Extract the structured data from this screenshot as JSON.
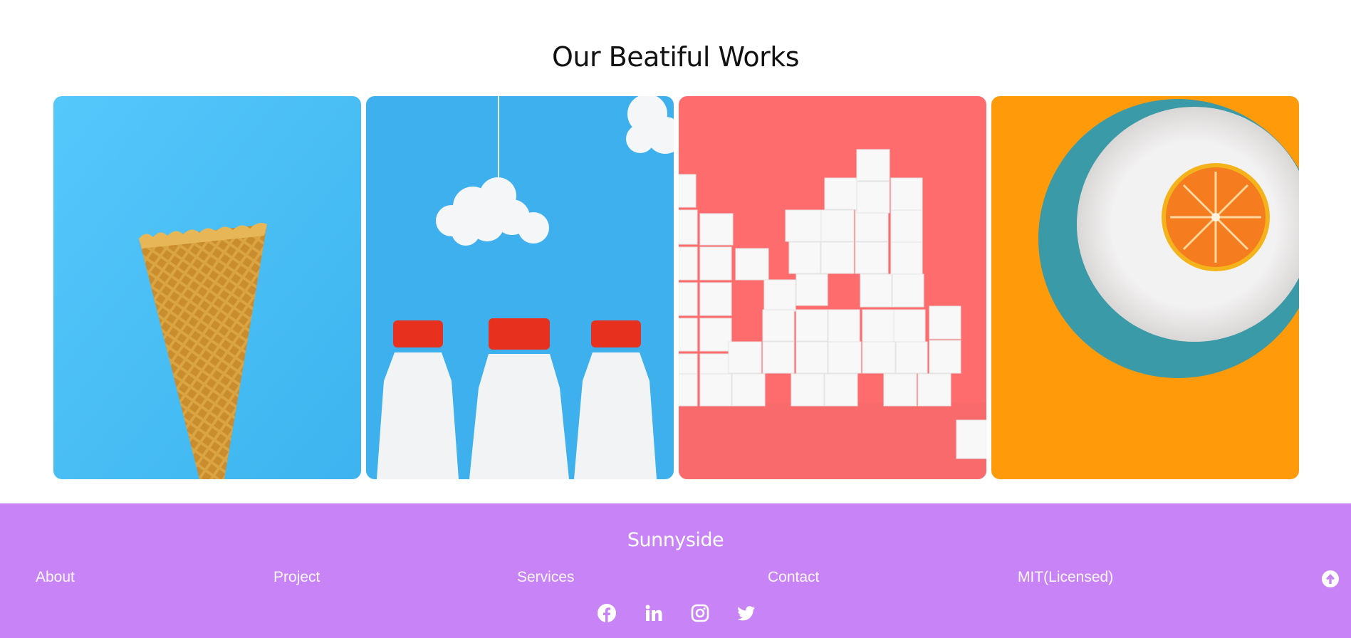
{
  "works": {
    "title": "Our Beatiful Works",
    "tiles": [
      {
        "subject": "ice-cream-cone",
        "bg": "#4fc3f7"
      },
      {
        "subject": "milk-bottles",
        "bg": "#3eaeec"
      },
      {
        "subject": "sugar-cubes",
        "bg": "#ff6b6b"
      },
      {
        "subject": "orange-on-plate",
        "bg": "#ff9c0a"
      }
    ]
  },
  "footer": {
    "bg": "#c883f7",
    "brand": "Sunnyside",
    "links": [
      "About",
      "Project",
      "Services",
      "Contact",
      "MIT(Licensed)"
    ],
    "scroll_top_icon": "arrow-up-circle-icon",
    "social": [
      "facebook-icon",
      "linkedin-icon",
      "instagram-icon",
      "twitter-icon"
    ]
  }
}
